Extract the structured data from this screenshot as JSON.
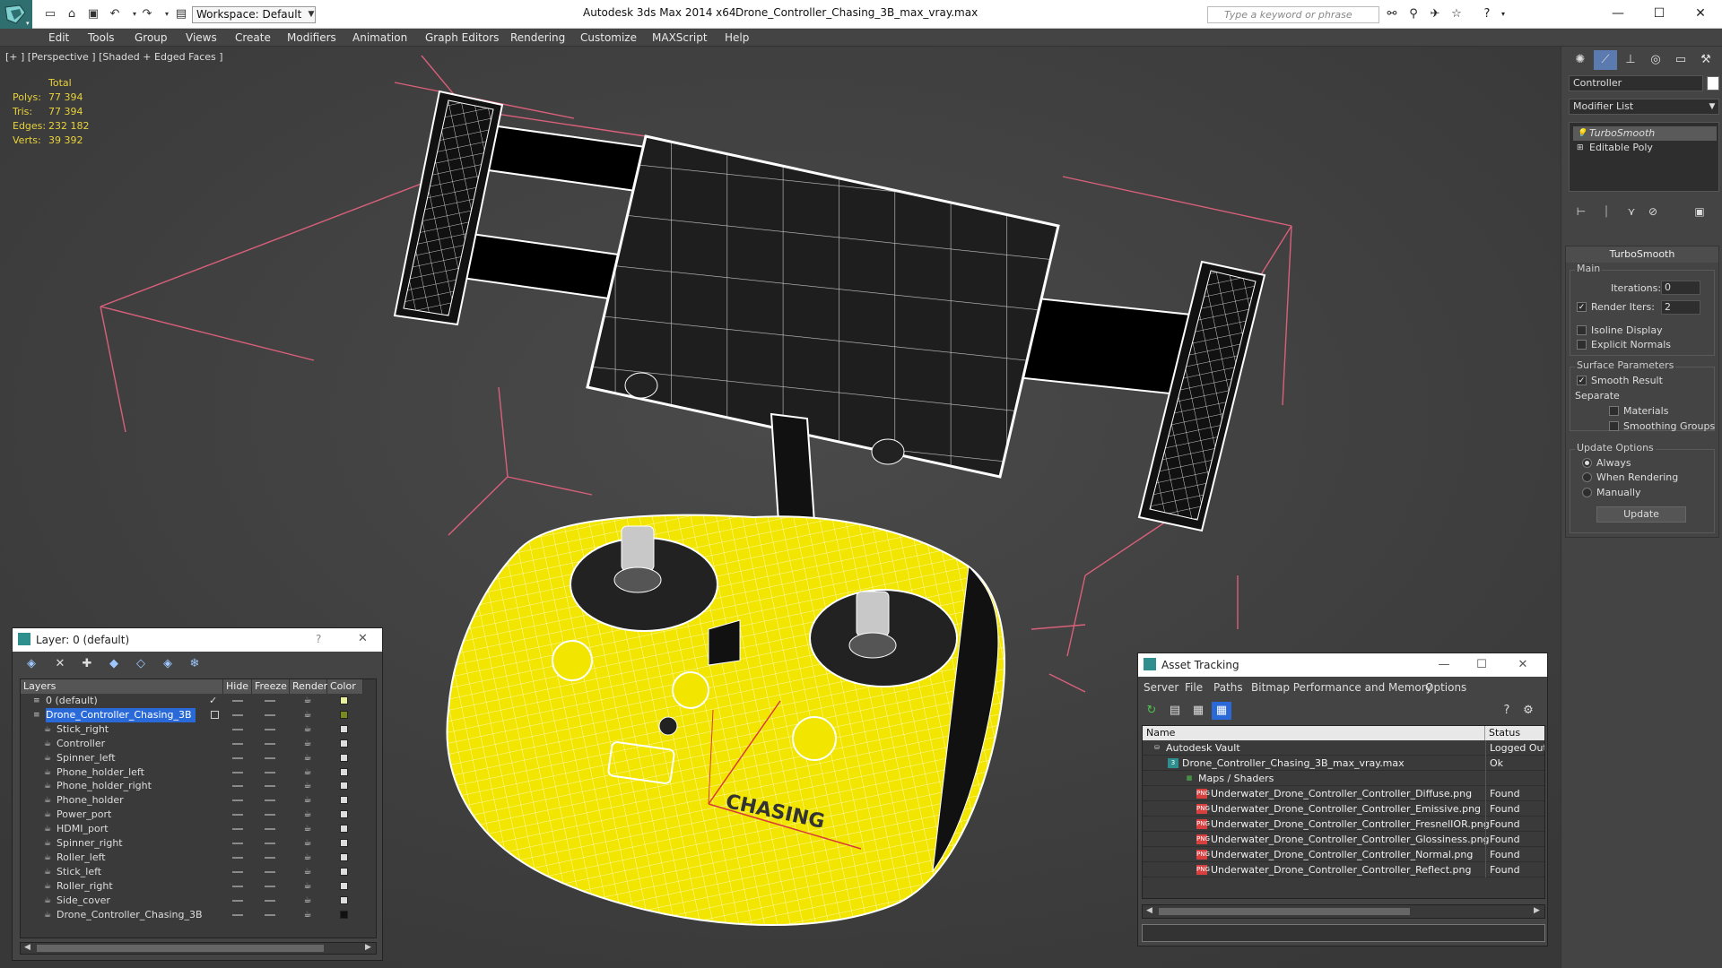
{
  "app": {
    "title": "Autodesk 3ds Max  2014 x64",
    "file": "Drone_Controller_Chasing_3B_max_vray.max",
    "workspace": "Workspace: Default",
    "search_placeholder": "Type a keyword or phrase"
  },
  "menu": [
    "Edit",
    "Tools",
    "Group",
    "Views",
    "Create",
    "Modifiers",
    "Animation",
    "Graph Editors",
    "Rendering",
    "Customize",
    "MAXScript",
    "Help"
  ],
  "viewport": {
    "label": "[+ ] [Perspective ] [Shaded + Edged Faces ]",
    "stats": {
      "header": "Total",
      "polys_label": "Polys:",
      "polys": "77 394",
      "tris_label": "Tris:",
      "tris": "77 394",
      "edges_label": "Edges:",
      "edges": "232 182",
      "verts_label": "Verts:",
      "verts": "39 392"
    },
    "model_text": "CHASING",
    "colors": {
      "model": "#f2e600",
      "wire": "#ffffff",
      "bbox": "#d9607a",
      "background": "#3f3f3f"
    }
  },
  "command_panel": {
    "object_name": "Controller",
    "modifier_list": "Modifier List",
    "stack": [
      "TurboSmooth",
      "Editable Poly"
    ],
    "turbosmooth": {
      "title": "TurboSmooth",
      "main_label": "Main",
      "iterations_label": "Iterations:",
      "iterations": "0",
      "render_iters_label": "Render Iters:",
      "render_iters": "2",
      "isoline": "Isoline Display",
      "explicit": "Explicit Normals",
      "surface_label": "Surface Parameters",
      "smooth_result": "Smooth Result",
      "separate_label": "Separate",
      "materials": "Materials",
      "smoothing_groups": "Smoothing Groups",
      "update_label": "Update Options",
      "always": "Always",
      "when_rendering": "When Rendering",
      "manually": "Manually",
      "update_button": "Update"
    }
  },
  "layer_dialog": {
    "title": "Layer: 0 (default)",
    "help": "?",
    "columns": {
      "layers": "Layers",
      "hide": "Hide",
      "freeze": "Freeze",
      "render": "Render",
      "color": "Color"
    },
    "rows": [
      {
        "name": "0 (default)",
        "level": 0,
        "type": "layer",
        "color": "#e8f0a0",
        "check": "✓"
      },
      {
        "name": "Drone_Controller_Chasing_3B",
        "level": 0,
        "type": "layer",
        "color": "#7a8a20",
        "selected": true
      },
      {
        "name": "Stick_right",
        "level": 1,
        "type": "object",
        "color": "#dddddd"
      },
      {
        "name": "Controller",
        "level": 1,
        "type": "object",
        "color": "#dddddd"
      },
      {
        "name": "Spinner_left",
        "level": 1,
        "type": "object",
        "color": "#dddddd"
      },
      {
        "name": "Phone_holder_left",
        "level": 1,
        "type": "object",
        "color": "#dddddd"
      },
      {
        "name": "Phone_holder_right",
        "level": 1,
        "type": "object",
        "color": "#dddddd"
      },
      {
        "name": "Phone_holder",
        "level": 1,
        "type": "object",
        "color": "#dddddd"
      },
      {
        "name": "Power_port",
        "level": 1,
        "type": "object",
        "color": "#dddddd"
      },
      {
        "name": "HDMI_port",
        "level": 1,
        "type": "object",
        "color": "#dddddd"
      },
      {
        "name": "Spinner_right",
        "level": 1,
        "type": "object",
        "color": "#dddddd"
      },
      {
        "name": "Roller_left",
        "level": 1,
        "type": "object",
        "color": "#dddddd"
      },
      {
        "name": "Stick_left",
        "level": 1,
        "type": "object",
        "color": "#dddddd"
      },
      {
        "name": "Roller_right",
        "level": 1,
        "type": "object",
        "color": "#dddddd"
      },
      {
        "name": "Side_cover",
        "level": 1,
        "type": "object",
        "color": "#dddddd"
      },
      {
        "name": "Drone_Controller_Chasing_3B",
        "level": 1,
        "type": "object",
        "color": "#111111"
      }
    ]
  },
  "asset_dialog": {
    "title": "Asset Tracking",
    "menu": [
      "Server",
      "File",
      "Paths",
      "Bitmap Performance and Memory",
      "Options"
    ],
    "columns": {
      "name": "Name",
      "status": "Status"
    },
    "rows": [
      {
        "name": "Autodesk Vault",
        "status": "Logged Out",
        "level": 0,
        "icon": "vault"
      },
      {
        "name": "Drone_Controller_Chasing_3B_max_vray.max",
        "status": "Ok",
        "level": 1,
        "icon": "max"
      },
      {
        "name": "Maps / Shaders",
        "status": "",
        "level": 2,
        "icon": "maps"
      },
      {
        "name": "Underwater_Drone_Controller_Controller_Diffuse.png",
        "status": "Found",
        "level": 3,
        "icon": "png"
      },
      {
        "name": "Underwater_Drone_Controller_Controller_Emissive.png",
        "status": "Found",
        "level": 3,
        "icon": "png"
      },
      {
        "name": "Underwater_Drone_Controller_Controller_FresnelIOR.png",
        "status": "Found",
        "level": 3,
        "icon": "png"
      },
      {
        "name": "Underwater_Drone_Controller_Controller_Glossiness.png",
        "status": "Found",
        "level": 3,
        "icon": "png"
      },
      {
        "name": "Underwater_Drone_Controller_Controller_Normal.png",
        "status": "Found",
        "level": 3,
        "icon": "png"
      },
      {
        "name": "Underwater_Drone_Controller_Controller_Reflect.png",
        "status": "Found",
        "level": 3,
        "icon": "png"
      }
    ]
  }
}
